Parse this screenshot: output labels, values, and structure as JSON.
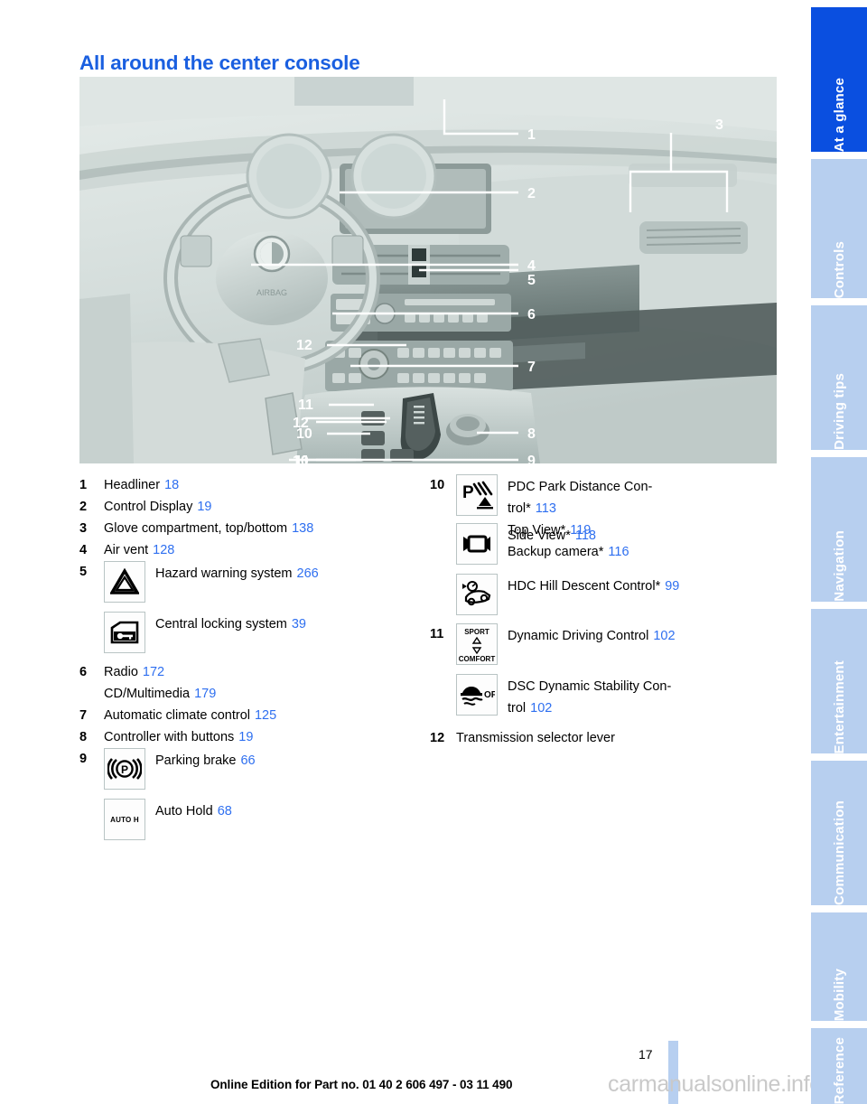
{
  "page": {
    "title": "All around the center console",
    "number": "17",
    "footer_note": "Online Edition for Part no. 01 40 2 606 497 - 03 11 490",
    "watermark": "carmanualsonline.info",
    "title_color": "#1a5fe0",
    "page_ref_color": "#2e6ff0"
  },
  "illustration": {
    "alt": "BMW dashboard and center console illustration",
    "callouts": [
      "1",
      "2",
      "3",
      "4",
      "5",
      "6",
      "7",
      "8",
      "9",
      "10",
      "11",
      "12"
    ]
  },
  "left_column": [
    {
      "num": "1",
      "lines": [
        {
          "text": "Headliner",
          "page": "18"
        }
      ]
    },
    {
      "num": "2",
      "lines": [
        {
          "text": "Control Display",
          "page": "19"
        }
      ]
    },
    {
      "num": "3",
      "lines": [
        {
          "text": "Glove compartment, top/bottom",
          "page": "138"
        }
      ]
    },
    {
      "num": "4",
      "lines": [
        {
          "text": "Air vent",
          "page": "128"
        }
      ]
    },
    {
      "num": "5",
      "icon_rows": [
        {
          "icon": "hazard-warning-triangle-icon",
          "text": "Hazard warning system",
          "page": "266"
        },
        {
          "icon": "central-locking-door-key-icon",
          "text": "Central locking system",
          "page": "39"
        }
      ]
    },
    {
      "num": "6",
      "lines": [
        {
          "text": "Radio",
          "page": "172"
        },
        {
          "text": "CD/Multimedia",
          "page": "179"
        }
      ]
    },
    {
      "num": "7",
      "lines": [
        {
          "text": "Automatic climate control",
          "page": "125"
        }
      ]
    },
    {
      "num": "8",
      "lines": [
        {
          "text": "Controller with buttons",
          "page": "19"
        }
      ]
    },
    {
      "num": "9",
      "icon_rows": [
        {
          "icon": "parking-brake-icon",
          "text": "Parking brake",
          "page": "66"
        },
        {
          "icon": "auto-hold-icon",
          "icon_text": "AUTO H",
          "text": "Auto Hold",
          "page": "68"
        }
      ]
    }
  ],
  "right_column": [
    {
      "num": "10",
      "icon_rows": [
        {
          "icon": "pdc-park-distance-control-icon",
          "text_lines": [
            "PDC Park Distance Con-",
            "trol*"
          ],
          "page": "113",
          "extra_lines": [
            {
              "text": "Top View*",
              "page": "119"
            },
            {
              "text": "Backup camera*",
              "page": "116"
            }
          ]
        },
        {
          "icon": "side-view-camera-icon",
          "text": "Side View*",
          "page": "118"
        },
        {
          "icon": "hdc-hill-descent-control-icon",
          "text": "HDC Hill Descent Control*",
          "page": "99"
        }
      ]
    },
    {
      "num": "11",
      "icon_rows": [
        {
          "icon": "dynamic-driving-control-icon",
          "icon_text_top": "SPORT",
          "icon_text_bottom": "COMFORT",
          "text": "Dynamic Driving Control",
          "page": "102"
        },
        {
          "icon": "dsc-off-icon",
          "icon_text": "OFF",
          "text_lines": [
            "DSC Dynamic Stability Con-",
            "trol"
          ],
          "page": "102"
        }
      ]
    },
    {
      "num": "12",
      "lines": [
        {
          "text": "Transmission selector lever",
          "page": ""
        }
      ]
    }
  ],
  "sidebar": {
    "active_color": "#0a4fe0",
    "inactive_color": "#b7cfef",
    "tabs": [
      {
        "label": "At a glance",
        "active": true
      },
      {
        "label": "Controls",
        "active": false
      },
      {
        "label": "Driving tips",
        "active": false
      },
      {
        "label": "Navigation",
        "active": false
      },
      {
        "label": "Entertainment",
        "active": false
      },
      {
        "label": "Communication",
        "active": false
      },
      {
        "label": "Mobility",
        "active": false
      },
      {
        "label": "Reference",
        "active": false
      }
    ]
  }
}
